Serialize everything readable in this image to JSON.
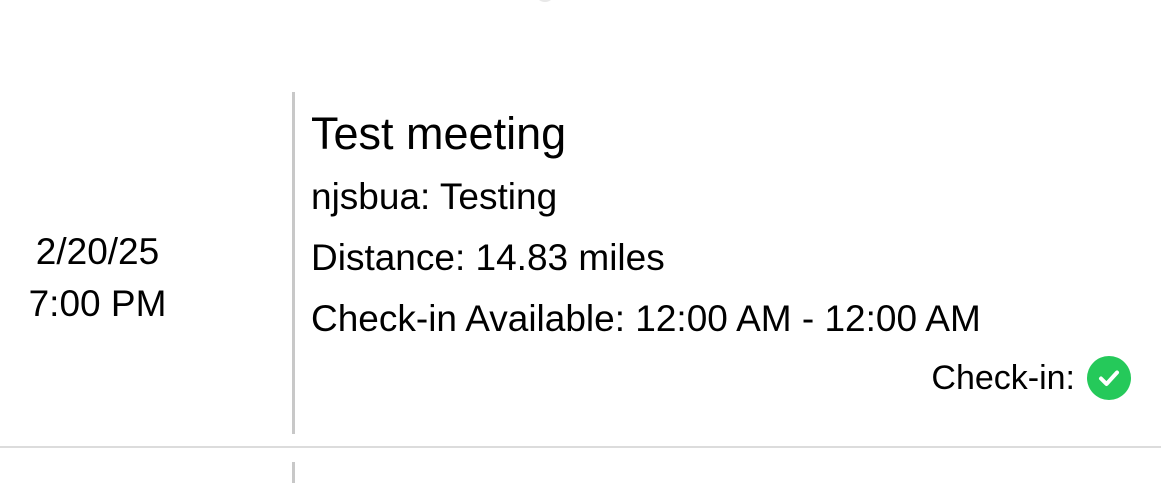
{
  "meeting": {
    "date": "2/20/25",
    "time": "7:00 PM",
    "title": "Test meeting",
    "group": "njsbua: Testing",
    "distance": "Distance: 14.83 miles",
    "checkin_window": "Check-in Available: 12:00 AM - 12:00 AM",
    "checkin_label": "Check-in:",
    "checkin_status_icon": "check-circle-icon",
    "checkin_status_color": "#25c95a"
  }
}
